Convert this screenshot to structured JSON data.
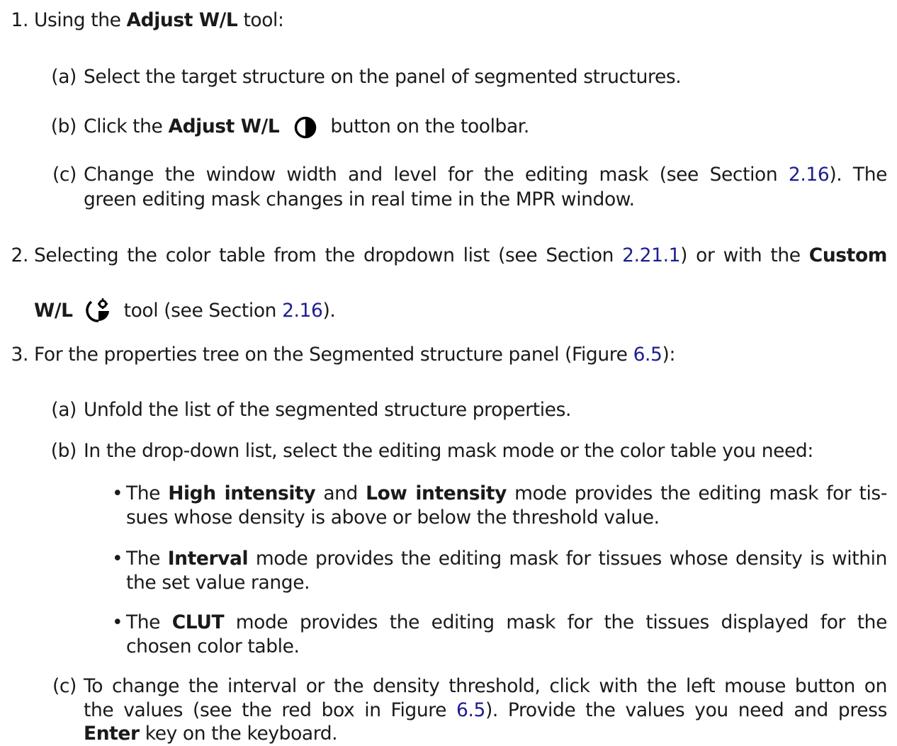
{
  "items": {
    "i1": {
      "num": "1.",
      "pre": "Using the ",
      "bold": "Adjust W/L",
      "post": " tool:",
      "a": {
        "label": "(a)",
        "text": "Select the target structure on the panel of segmented structures."
      },
      "b": {
        "label": "(b)",
        "pre": "Click the ",
        "bold": "Adjust W/L",
        "post": "button on the toolbar.",
        "icon": "contrast-half-circle-icon"
      },
      "c": {
        "label": "(c)",
        "l1_pre": "Change the window width and level for the editing mask (see Section ",
        "l1_ref": "2.16",
        "l1_post": ").  The",
        "l2": "green editing mask changes in real time in the MPR window."
      }
    },
    "i2": {
      "num": "2.",
      "l1_pre": "Selecting the color table from the dropdown list (see Section ",
      "l1_ref": "2.21.1",
      "l1_post": ") or with the ",
      "l1_bold": "Custom",
      "l2_bold": "W/L",
      "l2_pre": "tool (see Section ",
      "l2_ref": "2.16",
      "l2_post": ").",
      "icon": "custom-wl-icon"
    },
    "i3": {
      "num": "3.",
      "pre": "For the properties tree on the Segmented structure panel (Figure ",
      "ref": "6.5",
      "post": "):",
      "a": {
        "label": "(a)",
        "text": "Unfold the list of the segmented structure properties."
      },
      "b": {
        "label": "(b)",
        "text": "In the drop-down list, select the editing mask mode or the color table you need:",
        "bullets": {
          "b1": {
            "pre": "The ",
            "bold1": "High intensity",
            "mid": " and ",
            "bold2": "Low intensity",
            "post": " mode provides the editing mask for tis-",
            "l2": "sues whose density is above or below the threshold value."
          },
          "b2": {
            "pre": "The ",
            "bold": "Interval",
            "post": " mode provides the editing mask for tissues whose density is within",
            "l2": "the set value range."
          },
          "b3": {
            "pre": "The ",
            "bold": "CLUT",
            "post": " mode provides the editing mask for the tissues displayed for the",
            "l2": "chosen color table."
          }
        }
      },
      "c": {
        "label": "(c)",
        "l1": "To change the interval or the density threshold, click with the left mouse button on",
        "l2_pre": "the values (see the red box in Figure ",
        "l2_ref": "6.5",
        "l2_post": ").  Provide the values you need and press",
        "l3_bold": "Enter",
        "l3_post": " key on the keyboard."
      }
    }
  },
  "colors": {
    "link": "#1d1d8f",
    "text": "#1a1a1a"
  }
}
